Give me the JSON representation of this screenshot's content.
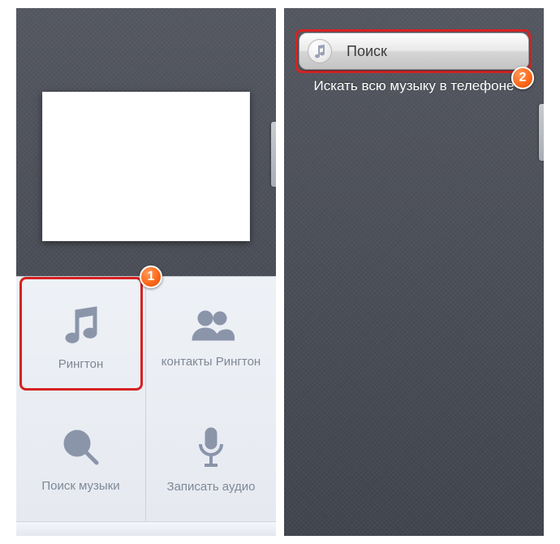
{
  "left": {
    "menu": {
      "ringtone": "Рингтон",
      "contacts": "контакты Рингтон",
      "searchMusic": "Поиск музыки",
      "recordAudio": "Записать аудио"
    }
  },
  "right": {
    "searchLabel": "Поиск",
    "hint": "Искать всю музыку в телефоне"
  },
  "badges": {
    "one": "1",
    "two": "2"
  }
}
